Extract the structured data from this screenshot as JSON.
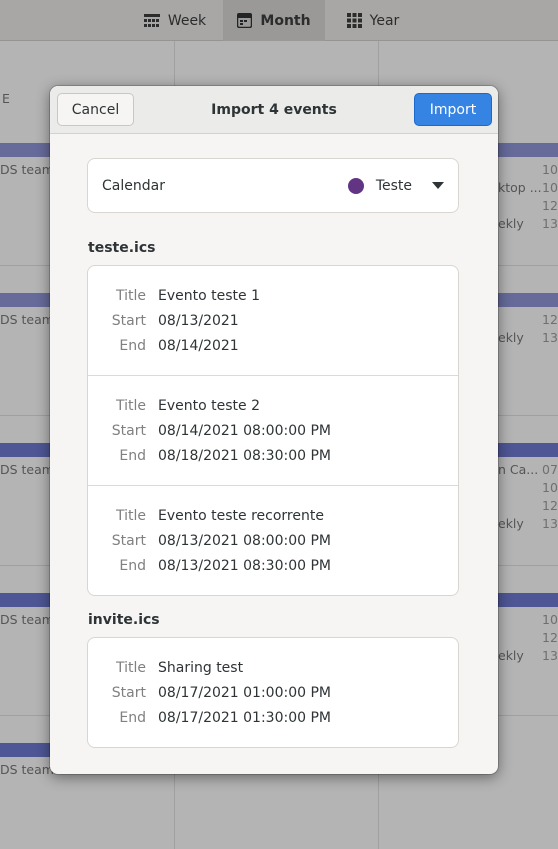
{
  "app": {
    "views": [
      {
        "label": "Week",
        "icon": "week-grid-icon",
        "active": false
      },
      {
        "label": "Month",
        "icon": "month-calendar-icon",
        "active": true
      },
      {
        "label": "Year",
        "icon": "year-grid-icon",
        "active": false
      }
    ],
    "background_events": {
      "left_label": "DS team",
      "left_label_last": "DS team ca",
      "right_labels": [
        "ktop ...",
        "ekly",
        "ekly",
        "n Ca...",
        "ekly",
        "ekly"
      ],
      "right_numbers": [
        "10",
        "10",
        "12",
        "13",
        "12",
        "13",
        "07",
        "10",
        "12",
        "13",
        "10",
        "12",
        "13"
      ]
    }
  },
  "dialog": {
    "title": "Import 4 events",
    "cancel_label": "Cancel",
    "import_label": "Import",
    "calendar": {
      "label": "Calendar",
      "selected": "Teste",
      "color": "#613583"
    },
    "labels": {
      "title": "Title",
      "start": "Start",
      "end": "End"
    },
    "files": [
      {
        "name": "teste.ics",
        "events": [
          {
            "title": "Evento teste 1",
            "start": "08/13/2021",
            "end": "08/14/2021"
          },
          {
            "title": "Evento teste 2",
            "start": "08/14/2021 08:00:00 PM",
            "end": "08/18/2021 08:30:00 PM"
          },
          {
            "title": "Evento teste recorrente",
            "start": "08/13/2021 08:00:00 PM",
            "end": "08/13/2021 08:30:00 PM"
          }
        ]
      },
      {
        "name": "invite.ics",
        "events": [
          {
            "title": "Sharing test",
            "start": "08/17/2021 01:00:00 PM",
            "end": "08/17/2021 01:30:00 PM"
          }
        ]
      }
    ]
  },
  "colors": {
    "accent": "#3584e4",
    "event_bar": "#8e95d6",
    "calendar_teste": "#613583"
  }
}
